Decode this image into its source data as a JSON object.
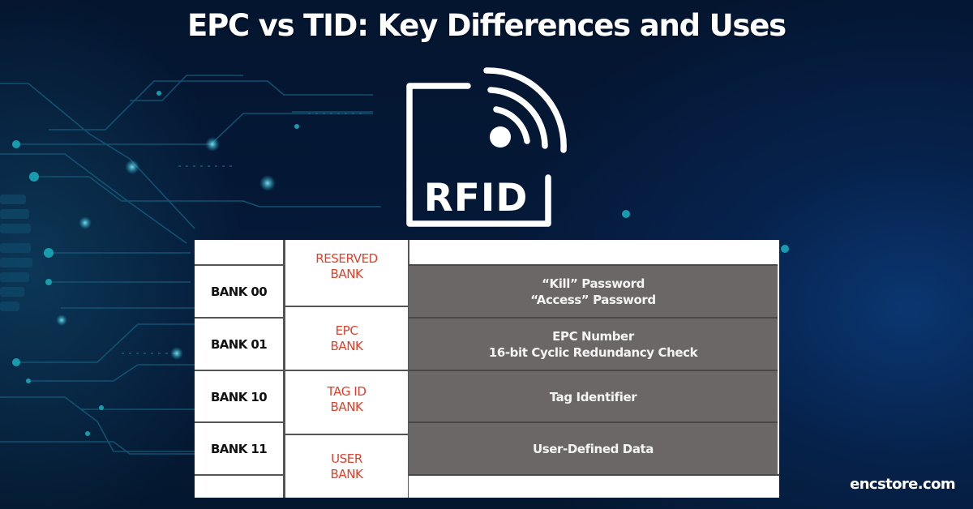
{
  "title": "EPC vs TID: Key Differences and Uses",
  "logo": {
    "icon": "rfid-tag-icon",
    "text": "RFID"
  },
  "memory_table": {
    "rows": [
      {
        "bank_code": "BANK 00",
        "bank_name_lines": [
          "RESERVED",
          "BANK"
        ],
        "contents_lines": [
          "“Kill” Password",
          "“Access” Password"
        ]
      },
      {
        "bank_code": "BANK 01",
        "bank_name_lines": [
          "EPC",
          "BANK"
        ],
        "contents_lines": [
          "EPC Number",
          "16-bit Cyclic Redundancy Check"
        ]
      },
      {
        "bank_code": "BANK 10",
        "bank_name_lines": [
          "TAG ID",
          "BANK"
        ],
        "contents_lines": [
          "Tag Identifier"
        ]
      },
      {
        "bank_code": "BANK 11",
        "bank_name_lines": [
          "USER",
          "BANK"
        ],
        "contents_lines": [
          "User-Defined Data"
        ]
      }
    ]
  },
  "brand": "encstore.com",
  "colors": {
    "background": "#04152f",
    "bank_name_red": "#e2402a",
    "contents_gray": "#6b6766",
    "text_white": "#ffffff",
    "circuit_teal": "#1aa8b8"
  }
}
